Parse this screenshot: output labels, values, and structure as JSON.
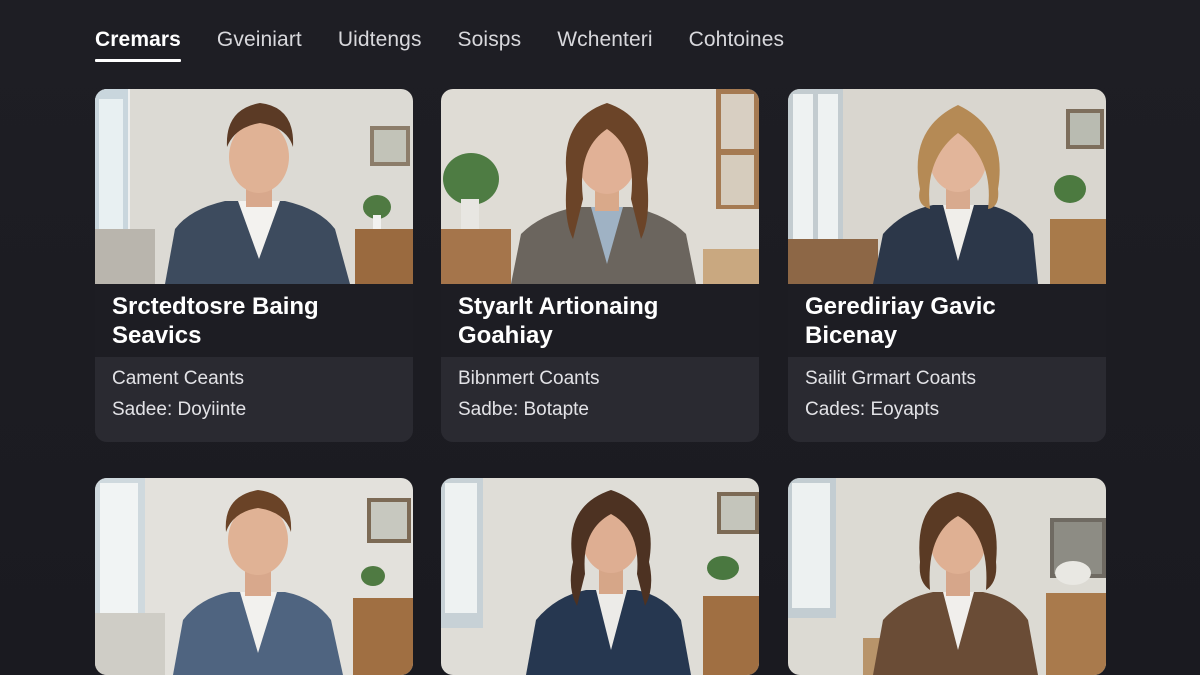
{
  "tabs": [
    {
      "label": "Cremars",
      "active": true
    },
    {
      "label": "Gveiniart",
      "active": false
    },
    {
      "label": "Uidtengs",
      "active": false
    },
    {
      "label": "Soisps",
      "active": false
    },
    {
      "label": "Wchenteri",
      "active": false
    },
    {
      "label": "Cohtoines",
      "active": false
    }
  ],
  "cards": [
    {
      "title": "Srctedtosre Baing Seavics",
      "meta1": "Cament Ceants",
      "meta2": "Sadee: Doyiinte"
    },
    {
      "title": "Styarlt Artionaing Goahiay",
      "meta1": "Bibnmert Coants",
      "meta2": "Sadbe: Botapte"
    },
    {
      "title": "Gerediriay Gavic Bicenay",
      "meta1": "Sailit Grmart Coants",
      "meta2": "Cades: Eoyapts"
    }
  ],
  "colors": {
    "background": "#1c1c22",
    "card_title_bg": "#1d1d23",
    "card_meta_bg": "#2a2a31",
    "text_primary": "#ffffff",
    "text_secondary": "#e2e2e6"
  }
}
